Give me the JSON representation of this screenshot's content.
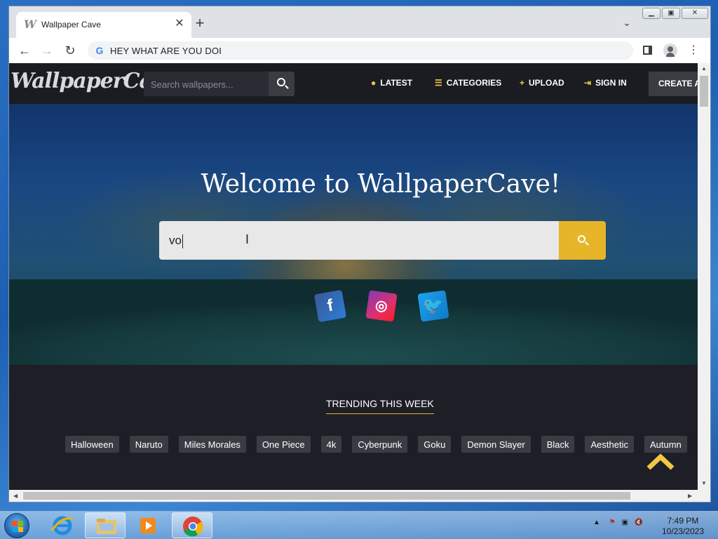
{
  "browser": {
    "tab_title": "Wallpaper Cave",
    "tab_favicon": "W",
    "address": "HEY WHAT ARE YOU DOI",
    "google_glyph": "G"
  },
  "site": {
    "logo": "WallpaperCave",
    "header_search_placeholder": "Search wallpapers...",
    "nav": {
      "latest": "LATEST",
      "categories": "CATEGORIES",
      "upload": "UPLOAD",
      "sign_in": "SIGN IN",
      "create": "CREATE A"
    },
    "hero": {
      "title": "Welcome to WallpaperCave!",
      "search_value": "vo"
    },
    "social": {
      "facebook": "f",
      "instagram": "◎",
      "twitter": "🐦"
    },
    "trending": {
      "title": "TRENDING THIS WEEK",
      "tags": [
        "Halloween",
        "Naruto",
        "Miles Morales",
        "One Piece",
        "4k",
        "Cyberpunk",
        "Goku",
        "Demon Slayer",
        "Black",
        "Aesthetic",
        "Autumn"
      ]
    }
  },
  "taskbar": {
    "time": "7:49 PM",
    "date": "10/23/2023"
  },
  "colors": {
    "accent": "#e7b427",
    "header_bg": "#1b1c22",
    "page_bg": "#1e1f26",
    "tag_bg": "#3a3c44"
  }
}
